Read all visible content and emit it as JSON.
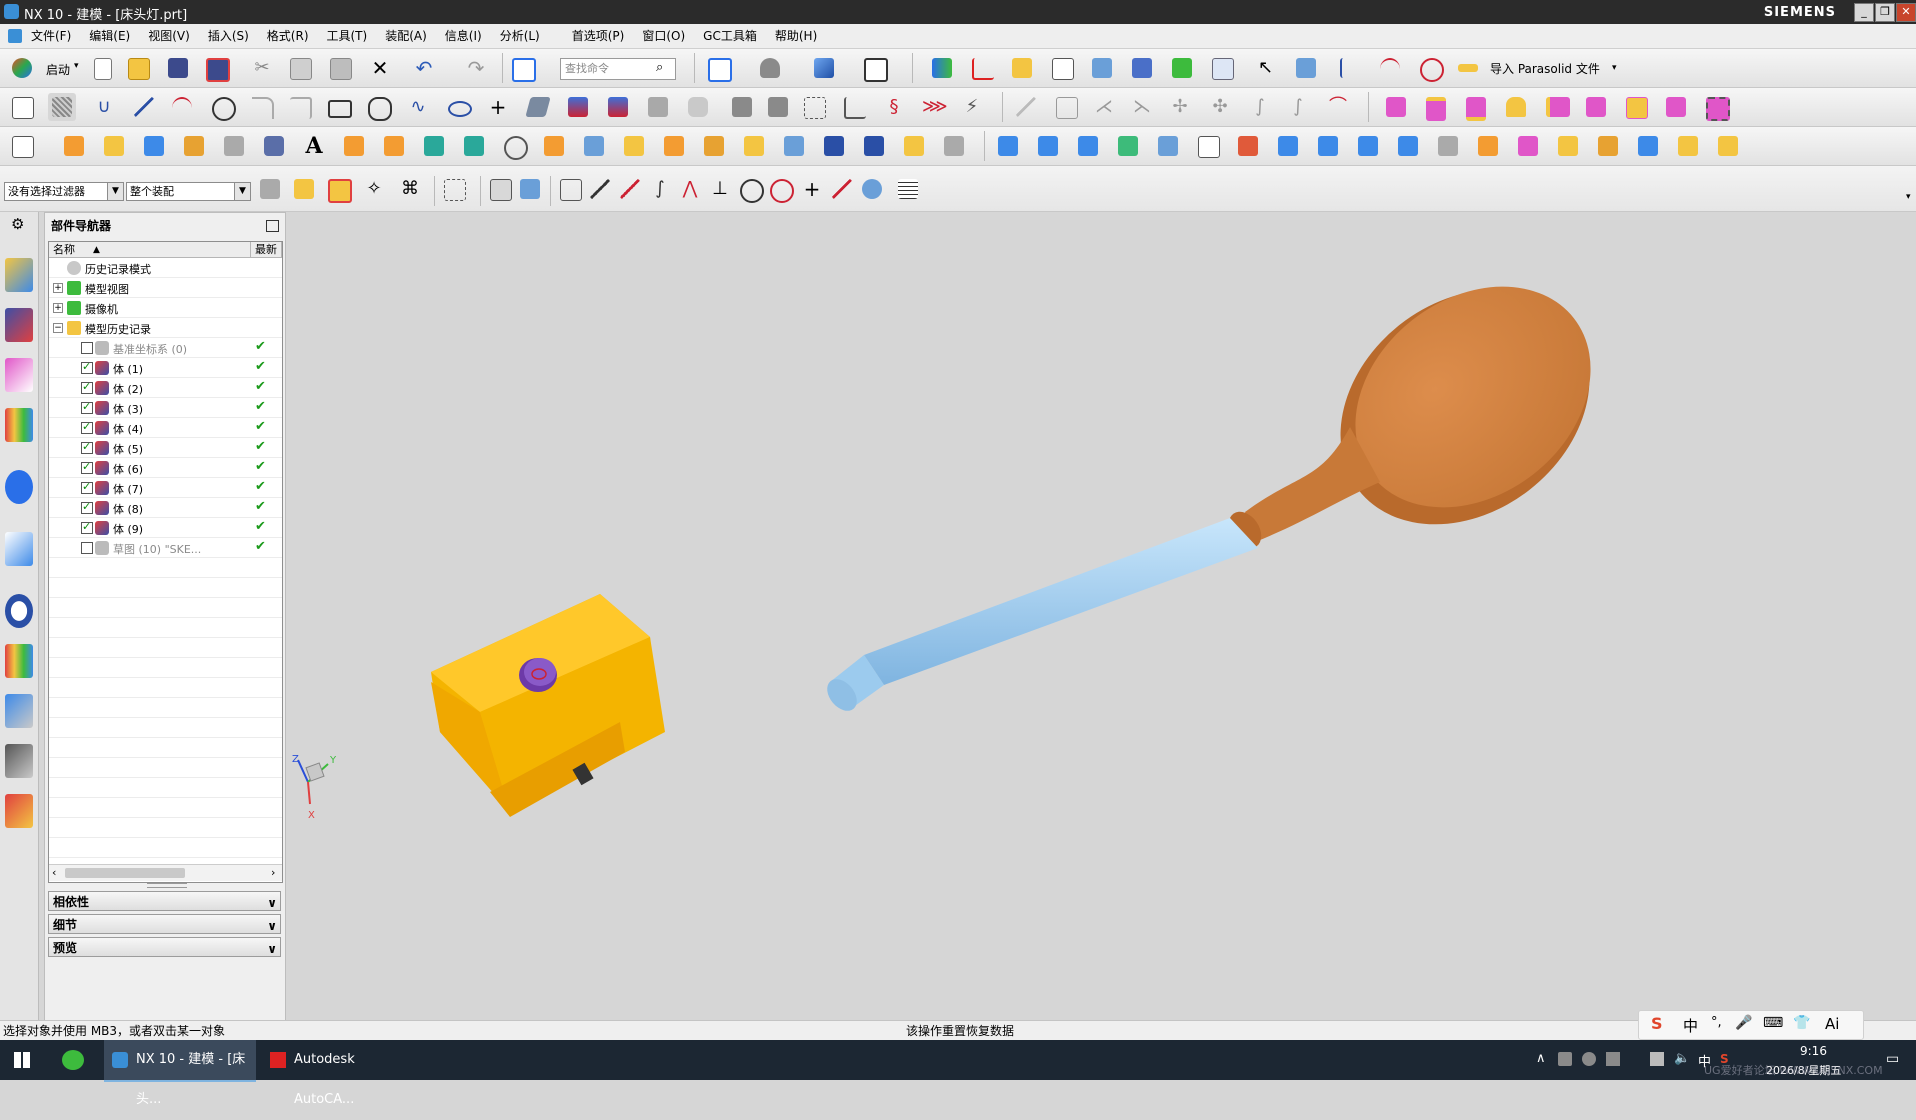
{
  "window": {
    "title": "NX 10 - 建模 - [床头灯.prt]",
    "brand": "SIEMENS",
    "controls": [
      "_",
      "❐",
      "✕"
    ]
  },
  "menu": {
    "items": [
      "文件(F)",
      "编辑(E)",
      "视图(V)",
      "插入(S)",
      "格式(R)",
      "工具(T)",
      "装配(A)",
      "信息(I)",
      "分析(L)",
      "首选项(P)",
      "窗口(O)",
      "GC工具箱",
      "帮助(H)"
    ]
  },
  "toolbar": {
    "start_label": "启动",
    "search_placeholder": "查找命令",
    "import_label": "导入 Parasolid 文件"
  },
  "selection_bar": {
    "filter": "没有选择过滤器",
    "scope": "整个装配"
  },
  "navigator": {
    "title": "部件导航器",
    "col_name": "名称",
    "col_latest": "最新",
    "items": [
      {
        "label": "历史记录模式",
        "level": 0,
        "expander": "",
        "checkbox": false,
        "latest": false
      },
      {
        "label": "模型视图",
        "level": 0,
        "expander": "+",
        "checkbox": false,
        "latest": false
      },
      {
        "label": "摄像机",
        "level": 0,
        "expander": "+",
        "checkbox": false,
        "latest": false
      },
      {
        "label": "模型历史记录",
        "level": 0,
        "expander": "−",
        "checkbox": false,
        "latest": false
      },
      {
        "label": "基准坐标系 (0)",
        "level": 1,
        "checkbox": "off",
        "latest": true,
        "dim": true
      },
      {
        "label": "体 (1)",
        "level": 1,
        "checkbox": "on",
        "latest": true
      },
      {
        "label": "体 (2)",
        "level": 1,
        "checkbox": "on",
        "latest": true
      },
      {
        "label": "体 (3)",
        "level": 1,
        "checkbox": "on",
        "latest": true
      },
      {
        "label": "体 (4)",
        "level": 1,
        "checkbox": "on",
        "latest": true
      },
      {
        "label": "体 (5)",
        "level": 1,
        "checkbox": "on",
        "latest": true
      },
      {
        "label": "体 (6)",
        "level": 1,
        "checkbox": "on",
        "latest": true
      },
      {
        "label": "体 (7)",
        "level": 1,
        "checkbox": "on",
        "latest": true
      },
      {
        "label": "体 (8)",
        "level": 1,
        "checkbox": "on",
        "latest": true
      },
      {
        "label": "体 (9)",
        "level": 1,
        "checkbox": "on",
        "latest": true
      },
      {
        "label": "草图 (10) \"SKE...",
        "level": 1,
        "checkbox": "off",
        "latest": true,
        "dim": true
      }
    ],
    "panels": [
      "相依性",
      "细节",
      "预览"
    ]
  },
  "status": {
    "left": "选择对象并使用 MB3，或者双击某一对象",
    "center": "该操作重置恢复数据"
  },
  "triad": {
    "x": "X",
    "y": "Y",
    "z": "Z"
  },
  "taskbar": {
    "apps": [
      "NX 10 - 建模 - [床头...",
      "Autodesk AutoCA..."
    ],
    "clock_time": "9:16",
    "clock_date": "2026/8/星期五",
    "watermark": "UG爱好者论坛 WWW.UGSNX.COM",
    "ime": [
      "中",
      "°,",
      "🎤",
      "⌨",
      "👕",
      "Ai"
    ]
  },
  "colors": {
    "viewport_bg": "#d6d6d6",
    "shade": "#d9863f",
    "handle": "#a9d3f3",
    "base": "#f4b400",
    "button": "#8a5ac8"
  }
}
